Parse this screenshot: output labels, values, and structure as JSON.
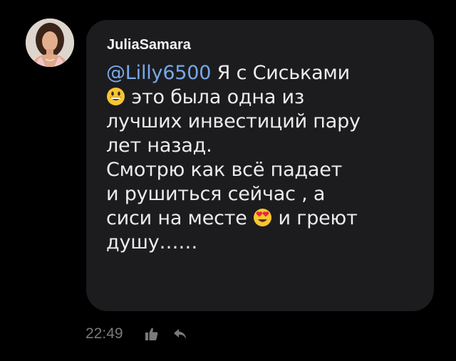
{
  "comment": {
    "author": "JuliaSamara",
    "mention": "@Lilly6500",
    "line1_text": " Я с Сиськами",
    "line2_text": " это была одна из",
    "line3": "лучших инвестиций пару",
    "line4": "лет назад.",
    "line5": "Смотрю как всё падает",
    "line6": "и рушиться сейчас , а",
    "line7_before": "сиси на месте ",
    "line7_after": " и греют",
    "line8": "душу……",
    "emojis": [
      "grinning-face-emoji",
      "heart-eyes-emoji"
    ],
    "time": "22:49"
  },
  "actions": {
    "like_icon": "thumbs-up-icon",
    "reply_icon": "reply-arrow-icon"
  },
  "colors": {
    "background": "#000000",
    "bubble": "#1c1c1e",
    "text": "#ececec",
    "mention": "#78a8e8",
    "meta": "#7a7a7a"
  }
}
